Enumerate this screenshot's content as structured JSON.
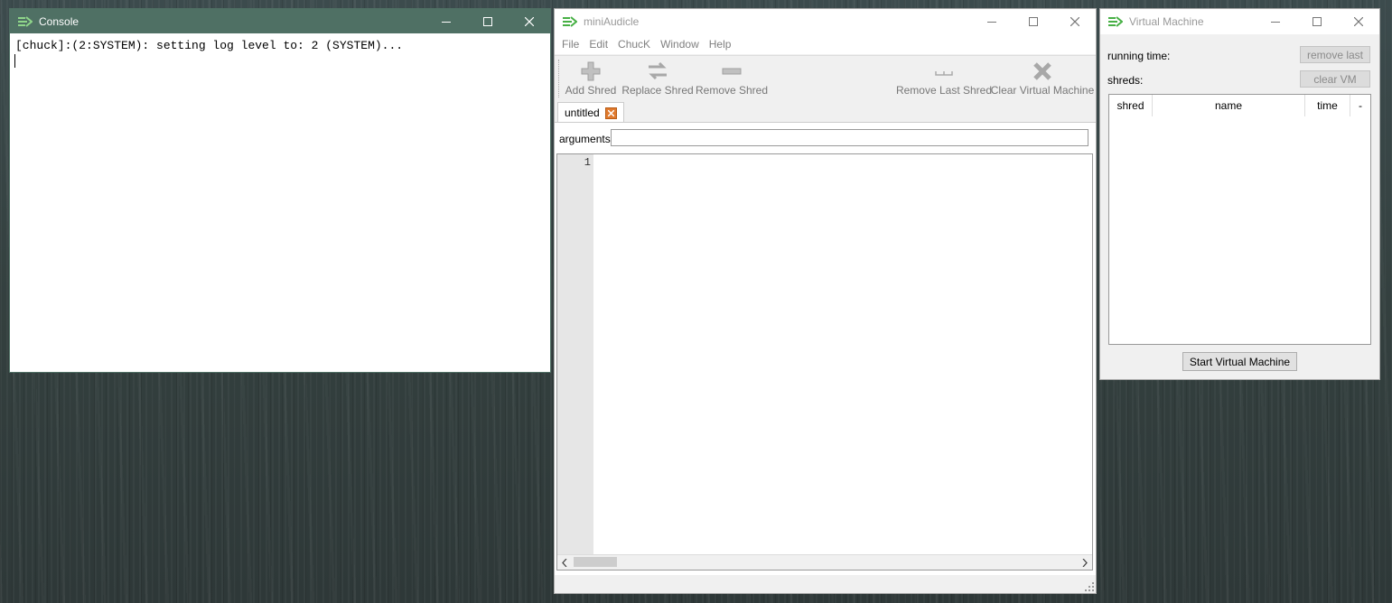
{
  "console": {
    "title": "Console",
    "lines": [
      "[chuck]:(2:SYSTEM): setting log level to: 2 (SYSTEM)..."
    ]
  },
  "mini": {
    "title": "miniAudicle",
    "menu": [
      "File",
      "Edit",
      "ChucK",
      "Window",
      "Help"
    ],
    "toolbar": {
      "add_shred": "Add Shred",
      "replace_shred": "Replace Shred",
      "remove_shred": "Remove Shred",
      "remove_last_shred": "Remove Last Shred",
      "clear_vm": "Clear Virtual Machine"
    },
    "tab": {
      "label": "untitled"
    },
    "arguments": {
      "label": "arguments",
      "value": ""
    },
    "editor": {
      "line_numbers": [
        "1"
      ]
    }
  },
  "vm": {
    "title": "Virtual Machine",
    "running_time_label": "running time:",
    "shreds_label": "shreds:",
    "remove_last_label": "remove last",
    "clear_vm_label": "clear VM",
    "table_headers": [
      "shred",
      "name",
      "time",
      "-"
    ],
    "start_button": "Start Virtual Machine"
  },
  "colors": {
    "console_titlebar": "#4f7064",
    "tab_close": "#e07a2e",
    "icon_green": "#47b045"
  }
}
